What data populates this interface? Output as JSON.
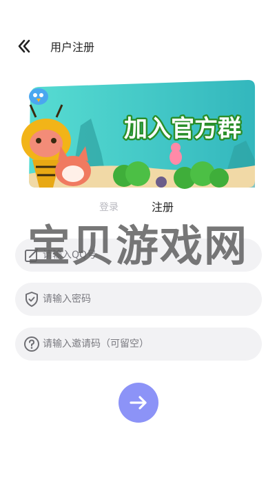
{
  "header": {
    "title": "用户注册"
  },
  "banner": {
    "text": "加入官方群"
  },
  "tabs": {
    "login": "登录",
    "register": "注册"
  },
  "form": {
    "phone_placeholder": "请输入QQ号",
    "password_placeholder": "请输入密码",
    "invite_placeholder": "请输入邀请码（可留空）"
  },
  "watermark": "宝贝游戏网",
  "colors": {
    "accent": "#8c93f7",
    "field_bg": "#f2f2f4",
    "banner_teal": "#3fcbc4"
  }
}
